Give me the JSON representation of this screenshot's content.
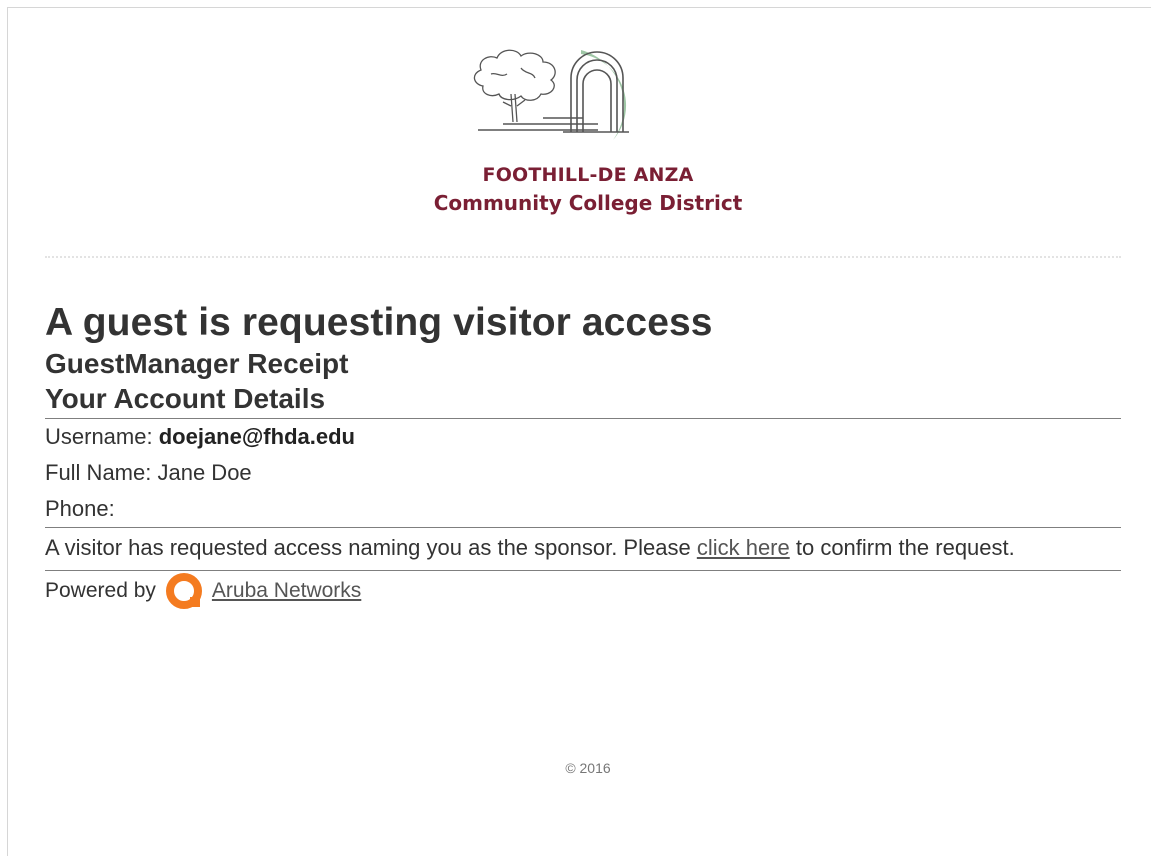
{
  "header": {
    "org_line1": "FOOTHILL-DE ANZA",
    "org_line2": "Community College District"
  },
  "content": {
    "title": "A guest is requesting visitor access",
    "subtitle": "GuestManager Receipt",
    "section_title": "Your Account Details",
    "username_label": "Username: ",
    "username_value": "doejane@fhda.edu",
    "fullname_label": "Full Name: ",
    "fullname_value": "Jane Doe",
    "phone_label": "Phone:",
    "message_before": "A visitor has requested access naming you as the sponsor. Please ",
    "message_link": "click here",
    "message_after": " to confirm the request."
  },
  "footer": {
    "powered_by": "Powered by",
    "aruba_link": "Aruba Networks",
    "copyright": "© 2016"
  },
  "colors": {
    "brand": "#7a1f34",
    "aruba_orange": "#f47b20",
    "arch_green": "#9fc7a6"
  }
}
